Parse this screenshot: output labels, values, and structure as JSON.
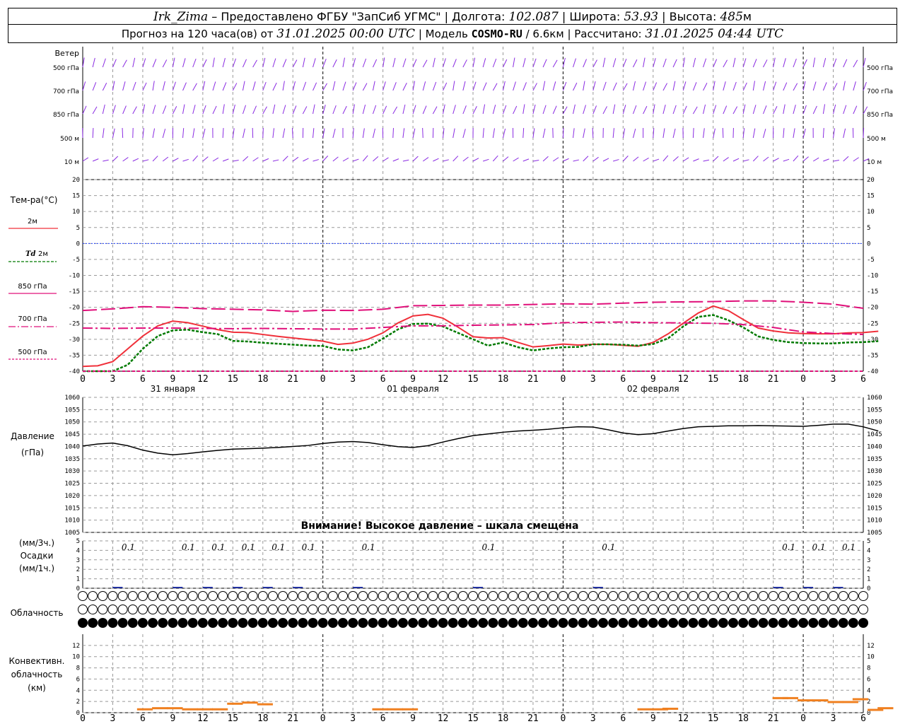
{
  "header": {
    "station": "Irk_Zima",
    "provider": " – Предоставлено ФГБУ \"ЗапСиб УГМС\" | Долгота: ",
    "lon": "102.087",
    "lat_label": " | Широта: ",
    "lat": "53.93",
    "alt_label": " | Высота: ",
    "alt": "485",
    "alt_unit": "м",
    "forecast": "Прогноз на 120 часа(ов) от ",
    "init": "31.01.2025 00:00 UTC",
    "model_label": " | Модель ",
    "model": "COSMO-RU",
    "res": " / 6.6",
    "res_unit": "км",
    "calc_label": " | Рассчитано: ",
    "calc": "31.01.2025 04:44 UTC"
  },
  "labels": {
    "wind": "Ветер",
    "wind_levels": [
      "500 гПа",
      "700 гПа",
      "850 гПа",
      "500 м",
      "10 м"
    ],
    "temp_title": "Тем-ра(°C)",
    "legend_2m": "2м",
    "legend_td": "Td",
    "legend_td2": "2м",
    "legend_850": "850 гПа",
    "legend_700": "700 гПа",
    "legend_500": "500 гПа",
    "pressure1": "Давление",
    "pressure2": "(гПа)",
    "pressure_warning": "Внимание! Высокое давление – шкала смещена",
    "precip1": "(мм/3ч.)",
    "precip2": "Осадки",
    "precip3": "(мм/1ч.)",
    "cloud": "Облачность",
    "conv1": "Конвективн.",
    "conv2": "облачность",
    "conv3": "(км)"
  },
  "colors": {
    "t2m": "#f0303a",
    "td": "#007a00",
    "t850": "#e0107a",
    "t700": "#e0107a",
    "t500": "#e0107a",
    "zero": "#2040ff",
    "wind": "#8a2be2",
    "pressure": "#000000",
    "conv": "#f08020",
    "precip": "#2030a0"
  },
  "chart_data": [
    {
      "type": "line",
      "name": "temperature",
      "x_ticks": [
        "0",
        "3",
        "6",
        "9",
        "12",
        "15",
        "18",
        "21",
        "0",
        "3",
        "6",
        "9",
        "12",
        "15",
        "18",
        "21",
        "0",
        "3",
        "6",
        "9",
        "12",
        "15",
        "18",
        "21",
        "0",
        "3",
        "6"
      ],
      "days": [
        "31 января",
        "01 февраля",
        "02 февраля"
      ],
      "ylim": [
        -40,
        20
      ],
      "y_ticks": [
        20,
        15,
        10,
        5,
        0,
        -5,
        -10,
        -15,
        -20,
        -25,
        -30,
        -35,
        -40
      ],
      "series": [
        {
          "key": "t2m",
          "x": [
            0,
            1.5,
            3,
            4.5,
            6,
            7.5,
            9,
            10.5,
            12,
            13.5,
            15,
            16.5,
            18,
            19.5,
            21,
            22.5,
            24,
            25.5,
            27,
            28.5,
            30,
            31.5,
            33,
            34.5,
            36,
            37.5,
            39,
            40.5,
            42,
            43.5,
            45,
            46.5,
            48,
            49.5,
            51,
            52.5,
            54,
            55.5,
            57,
            58.5,
            60,
            61.5,
            63,
            64.5,
            66,
            67.5,
            69,
            70.5,
            72,
            73.5,
            75,
            76.5,
            78,
            79.5
          ],
          "y": [
            -38.5,
            -38.3,
            -37,
            -33,
            -29,
            -25.8,
            -24.3,
            -24.8,
            -25.9,
            -27,
            -27.8,
            -27.9,
            -28.5,
            -29.1,
            -29.6,
            -30.1,
            -30.6,
            -31.6,
            -31.2,
            -30,
            -28,
            -24.9,
            -22.7,
            -22.2,
            -23.4,
            -26.2,
            -29.2,
            -29.6,
            -29.5,
            -31,
            -32.4,
            -32,
            -31.5,
            -31.8,
            -31.6,
            -31.6,
            -31.9,
            -32.2,
            -31,
            -28.3,
            -25,
            -21.8,
            -19.6,
            -21,
            -23.8,
            -26.5,
            -27.4,
            -28,
            -28.2,
            -28.3,
            -28.3,
            -28,
            -27.9,
            -27.5
          ]
        },
        {
          "key": "td",
          "x": [
            0,
            1.5,
            3,
            4.5,
            6,
            7.5,
            9,
            10.5,
            12,
            13.5,
            15,
            16.5,
            18,
            19.5,
            21,
            22.5,
            24,
            25.5,
            27,
            28.5,
            30,
            31.5,
            33,
            34.5,
            36,
            37.5,
            39,
            40.5,
            42,
            43.5,
            45,
            46.5,
            48,
            49.5,
            51,
            52.5,
            54,
            55.5,
            57,
            58.5,
            60,
            61.5,
            63,
            64.5,
            66,
            67.5,
            69,
            70.5,
            72,
            73.5,
            75,
            76.5,
            78,
            79.5
          ],
          "y": [
            -42,
            -42,
            -42,
            -38,
            -33,
            -29,
            -27.2,
            -27,
            -27.8,
            -28.4,
            -30.5,
            -30.7,
            -31.1,
            -31.4,
            -31.7,
            -32,
            -32.1,
            -33.2,
            -33.5,
            -32.5,
            -29.8,
            -26.9,
            -25.2,
            -25.1,
            -26,
            -28,
            -30,
            -32,
            -31,
            -32.5,
            -33.5,
            -32.9,
            -32.5,
            -32.4,
            -31.6,
            -31.6,
            -31.7,
            -32,
            -31.5,
            -29.7,
            -26,
            -23,
            -22.4,
            -24,
            -26.3,
            -29.1,
            -30.2,
            -30.9,
            -31.2,
            -31.3,
            -31.3,
            -31,
            -30.9,
            -30.6
          ]
        },
        {
          "key": "t850",
          "x": [
            0,
            3,
            6,
            9,
            12,
            15,
            18,
            21,
            24,
            27,
            30,
            33,
            36,
            39,
            42,
            45,
            48,
            51,
            54,
            57,
            60,
            63,
            66,
            69,
            72,
            75,
            78
          ],
          "y": [
            -21,
            -20.5,
            -19.8,
            -20,
            -20.4,
            -20.6,
            -20.8,
            -21.3,
            -20.9,
            -21,
            -20.6,
            -19.5,
            -19.4,
            -19.3,
            -19.3,
            -19.1,
            -18.9,
            -19,
            -18.7,
            -18.4,
            -18.3,
            -18.2,
            -18,
            -18,
            -18.4,
            -19,
            -20.3
          ]
        },
        {
          "key": "t700",
          "x": [
            0,
            3,
            6,
            9,
            12,
            15,
            18,
            21,
            24,
            27,
            30,
            33,
            36,
            39,
            42,
            45,
            48,
            51,
            54,
            57,
            60,
            63,
            66,
            69,
            72,
            75,
            78
          ],
          "y": [
            -26.5,
            -26.6,
            -26.5,
            -26.5,
            -26.6,
            -26.7,
            -26.6,
            -26.7,
            -26.8,
            -26.8,
            -26.3,
            -25.8,
            -25.8,
            -25.6,
            -25.5,
            -25.4,
            -24.8,
            -24.7,
            -24.6,
            -24.8,
            -24.9,
            -25.0,
            -25.4,
            -26.3,
            -27.7,
            -28.2,
            -28.5
          ]
        },
        {
          "key": "t500",
          "x": [
            0,
            3,
            6,
            9,
            12,
            15,
            18,
            21,
            24,
            27,
            30,
            33,
            36,
            39,
            42,
            45,
            48,
            51,
            54,
            57,
            60,
            63,
            66,
            69,
            72,
            75,
            78
          ],
          "y": [
            -41,
            -41,
            -41,
            -41,
            -41,
            -41,
            -41,
            -41,
            -41,
            -41,
            -41,
            -40.5,
            -40,
            -40.2,
            -41,
            -41,
            -41,
            -41,
            -41,
            -41,
            -41,
            -41,
            -41,
            -41,
            -40.5,
            -41,
            -41
          ]
        }
      ]
    },
    {
      "type": "line",
      "name": "pressure",
      "ylim": [
        1005,
        1060
      ],
      "y_ticks": [
        1060,
        1055,
        1050,
        1045,
        1040,
        1035,
        1030,
        1025,
        1020,
        1015,
        1010,
        1005
      ],
      "x": [
        0,
        1.5,
        3,
        4.5,
        6,
        7.5,
        9,
        10.5,
        12,
        13.5,
        15,
        16.5,
        18,
        19.5,
        21,
        22.5,
        24,
        25.5,
        27,
        28.5,
        30,
        31.5,
        33,
        34.5,
        36,
        37.5,
        39,
        40.5,
        42,
        43.5,
        45,
        46.5,
        48,
        49.5,
        51,
        52.5,
        54,
        55.5,
        57,
        58.5,
        60,
        61.5,
        63,
        64.5,
        66,
        67.5,
        69,
        70.5,
        72,
        73.5,
        75,
        76.5,
        78,
        79.5
      ],
      "values": [
        1040.2,
        1041,
        1041.4,
        1040.3,
        1038.5,
        1037.3,
        1036.6,
        1037.1,
        1037.8,
        1038.4,
        1038.9,
        1039.1,
        1039.3,
        1039.6,
        1040,
        1040.4,
        1041.2,
        1041.8,
        1042,
        1041.6,
        1040.7,
        1039.9,
        1039.6,
        1040.3,
        1041.8,
        1043.2,
        1044.4,
        1045.1,
        1045.8,
        1046.3,
        1046.6,
        1047,
        1047.6,
        1048,
        1047.9,
        1046.8,
        1045.5,
        1044.8,
        1045.2,
        1046.3,
        1047.3,
        1048,
        1048.2,
        1048.4,
        1048.4,
        1048.5,
        1048.4,
        1048.3,
        1048.2,
        1048.6,
        1049.1,
        1049.1,
        1048,
        1046.3
      ]
    },
    {
      "type": "bar",
      "name": "precipitation",
      "ylim": [
        0,
        5
      ],
      "y_ticks": [
        5,
        4,
        3,
        2,
        1,
        0
      ],
      "label_x": [
        3,
        9,
        12,
        15,
        18,
        21,
        27,
        39,
        51,
        69,
        72,
        75
      ],
      "label_values": [
        "0.1",
        "0.1",
        "0.1",
        "0.1",
        "0.1",
        "0.1",
        "0.1",
        "0.1",
        "0.1",
        "0.1",
        "0.1",
        "0.1"
      ]
    },
    {
      "type": "bar",
      "name": "convective_clouds",
      "ylim": [
        0,
        14
      ],
      "y_ticks": [
        12,
        10,
        8,
        6,
        4,
        2,
        0
      ],
      "x": [
        5.5,
        7,
        8.5,
        10,
        11.5,
        13,
        14.5,
        16,
        17.5,
        29,
        30.5,
        32,
        55.5,
        57,
        58,
        69,
        70,
        71.5,
        73,
        74.5,
        76,
        77,
        78.5,
        79.5
      ],
      "values": [
        0.6,
        0.8,
        0.8,
        0.6,
        0.6,
        0.6,
        1.6,
        1.8,
        1.5,
        0.6,
        0.6,
        0.6,
        0.6,
        0.6,
        0.7,
        2.6,
        2.6,
        2.2,
        2.2,
        1.9,
        1.9,
        2.4,
        0.5,
        0.8
      ]
    }
  ]
}
